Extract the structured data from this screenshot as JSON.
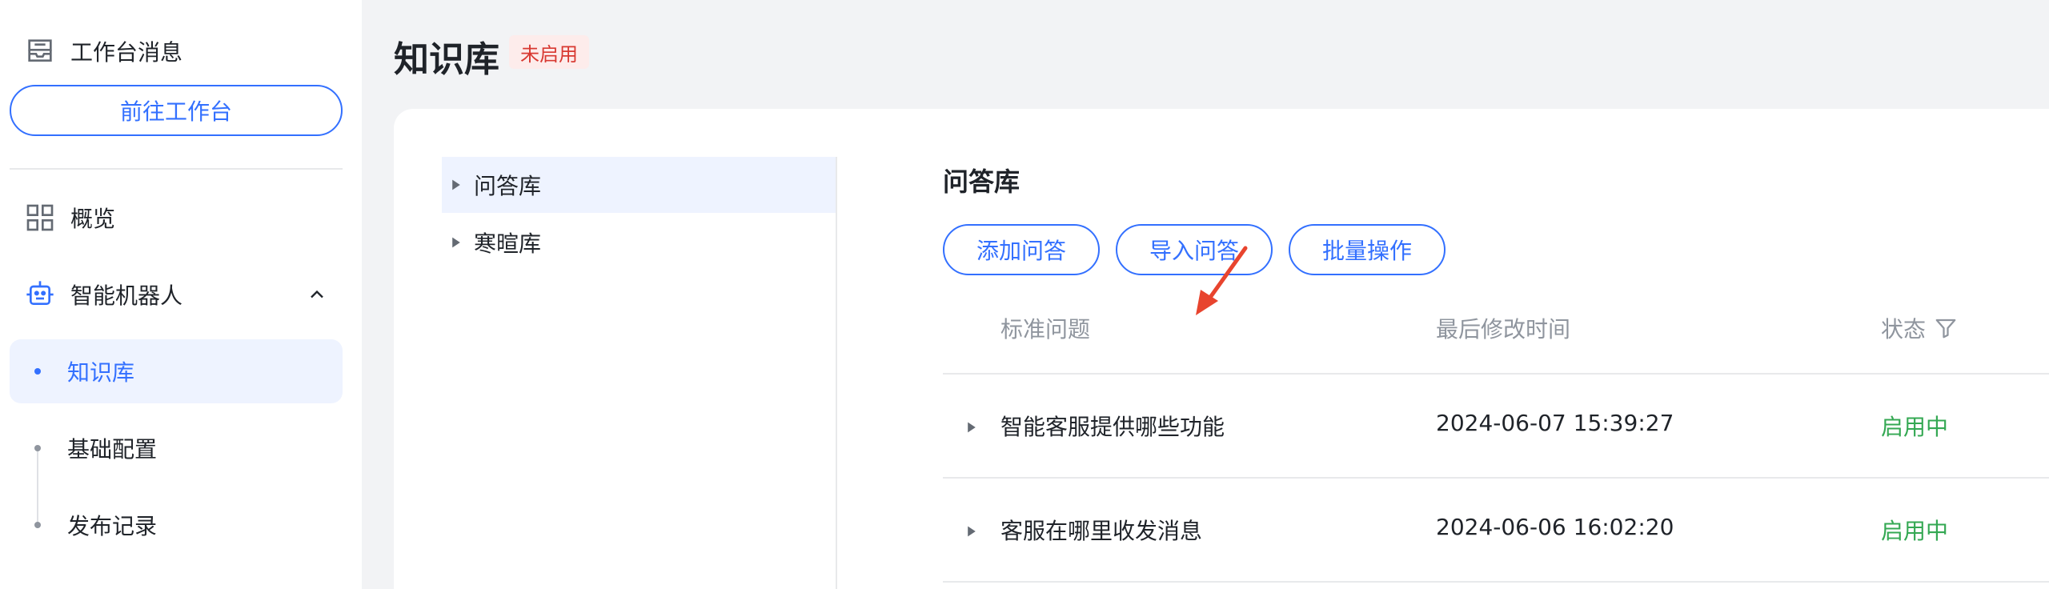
{
  "sidebar": {
    "header_label": "工作台消息",
    "goto_button": "前往工作台",
    "nav": {
      "overview": "概览",
      "robot": "智能机器人"
    },
    "sub_items": [
      "知识库",
      "基础配置",
      "发布记录"
    ],
    "active_sub": "知识库"
  },
  "page": {
    "title": "知识库",
    "status_tag": "未启用"
  },
  "tree": {
    "nodes": [
      "问答库",
      "寒暄库"
    ],
    "selected": "问答库"
  },
  "content": {
    "title": "问答库",
    "buttons": {
      "add": "添加问答",
      "import": "导入问答",
      "batch": "批量操作"
    },
    "table": {
      "headers": {
        "question": "标准问题",
        "modified": "最后修改时间",
        "status": "状态"
      },
      "rows": [
        {
          "question": "智能客服提供哪些功能",
          "modified": "2024-06-07 15:39:27",
          "status": "启用中"
        },
        {
          "question": "客服在哪里收发消息",
          "modified": "2024-06-06 16:02:20",
          "status": "启用中"
        }
      ]
    }
  },
  "colors": {
    "accent": "#3370ff",
    "status_enabled": "#34a853",
    "tag_red": "#d83931",
    "annotation_arrow": "#e8442e"
  },
  "icons": {
    "header": "inbox-icon",
    "overview": "grid-icon",
    "robot": "robot-icon",
    "collapse": "chevron-up-icon",
    "filter": "filter-icon",
    "expand": "caret-right-icon"
  }
}
